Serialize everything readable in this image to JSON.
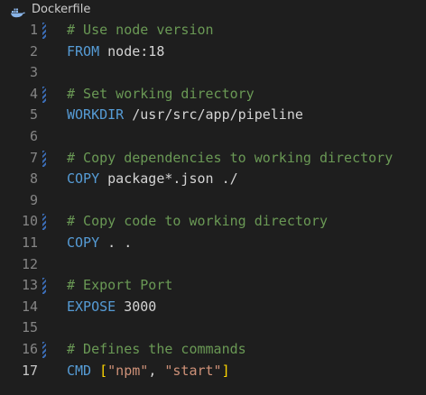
{
  "tab": {
    "title": "Dockerfile",
    "icon": "docker-icon"
  },
  "colors": {
    "comment": "#6a9955",
    "keyword": "#569cd6",
    "string": "#ce9178",
    "bracket": "#ffd700",
    "text": "#d4d4d4",
    "line_number": "#858585",
    "background": "#1e1e1e"
  },
  "editor": {
    "active_line": 17,
    "lines": [
      {
        "number": "1",
        "comment": "# Use node version"
      },
      {
        "number": "2",
        "keyword": "FROM",
        "args": " node:18"
      },
      {
        "number": "3"
      },
      {
        "number": "4",
        "comment": "# Set working directory"
      },
      {
        "number": "5",
        "keyword": "WORKDIR",
        "args": " /usr/src/app/pipeline"
      },
      {
        "number": "6"
      },
      {
        "number": "7",
        "comment": "# Copy dependencies to working directory"
      },
      {
        "number": "8",
        "keyword": "COPY",
        "args": " package*.json ./"
      },
      {
        "number": "9"
      },
      {
        "number": "10",
        "comment": "# Copy code to working directory"
      },
      {
        "number": "11",
        "keyword": "COPY",
        "args": " . ."
      },
      {
        "number": "12"
      },
      {
        "number": "13",
        "comment": "# Export Port"
      },
      {
        "number": "14",
        "keyword": "EXPOSE",
        "args": " 3000"
      },
      {
        "number": "15"
      },
      {
        "number": "16",
        "comment": "# Defines the commands"
      },
      {
        "number": "17",
        "keyword": "CMD",
        "bracket_open": "[",
        "string1": "\"npm\"",
        "sep": ", ",
        "string2": "\"start\"",
        "bracket_close": "]"
      }
    ]
  }
}
